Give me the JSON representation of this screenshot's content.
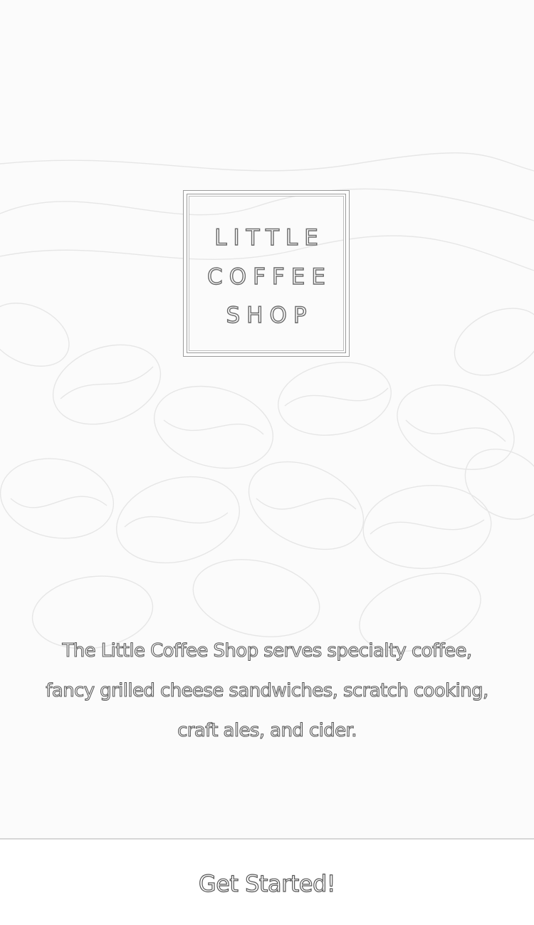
{
  "logo": {
    "line1": "LITTLE",
    "line2": "COFFEE",
    "line3": "SHOP"
  },
  "tagline": "The Little Coffee Shop serves specialty coffee, fancy grilled cheese sandwiches, scratch cooking, craft ales, and cider.",
  "footer": {
    "cta_label": "Get Started!"
  },
  "colors": {
    "background": "#fbfbfb",
    "outline": "#6a6a6a",
    "divider": "#d6d6d6"
  },
  "background_image": "coffee-beans-illustration"
}
